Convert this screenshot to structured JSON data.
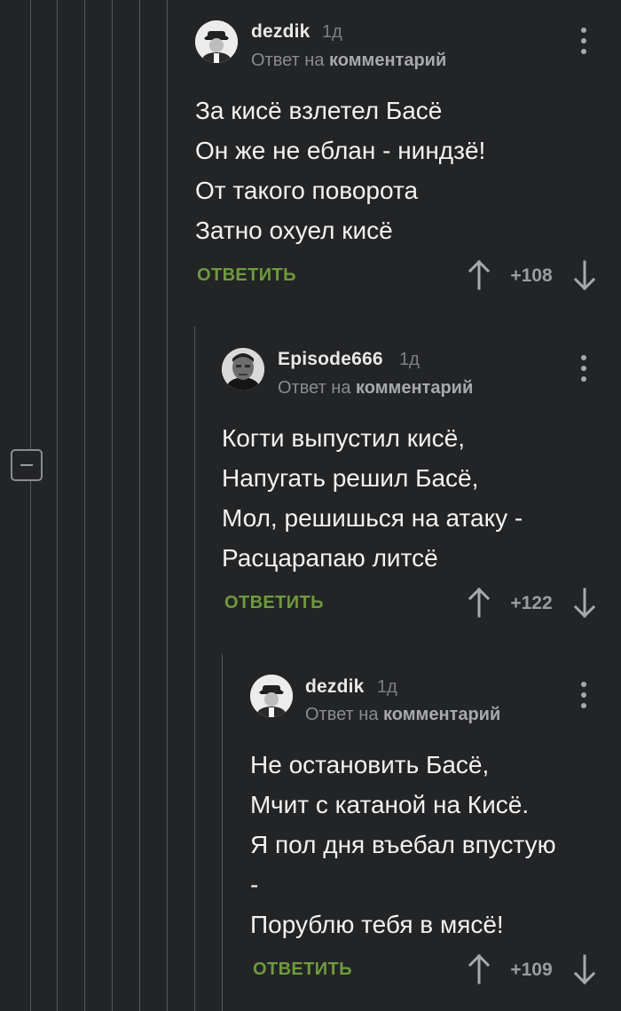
{
  "thread": {
    "collapse_icon": "minus-icon",
    "comments": [
      {
        "author": "dezdik",
        "age": "1д",
        "reply_prefix": "Ответ на",
        "reply_target": "комментарий",
        "lines": [
          "За кисё взлетел Басё",
          "Он же не еблан - ниндзё!",
          "От такого поворота",
          "Затно охуел кисё"
        ],
        "reply_label": "ОТВЕТИТЬ",
        "score": "+108"
      },
      {
        "author": "Episode666",
        "age": "1д",
        "reply_prefix": "Ответ на",
        "reply_target": "комментарий",
        "lines": [
          "Когти выпустил кисё,",
          "Напугать решил Басё,",
          "Мол, решишься на атаку -",
          "Расцарапаю литсё"
        ],
        "reply_label": "ОТВЕТИТЬ",
        "score": "+122"
      },
      {
        "author": "dezdik",
        "age": "1д",
        "reply_prefix": "Ответ на",
        "reply_target": "комментарий",
        "lines": [
          "Не остановить Басё,",
          "Мчит с катаной на Кисё.",
          "Я пол дня въебал впустую",
          "-",
          "Порублю тебя в мясё!"
        ],
        "reply_label": "ОТВЕТИТЬ",
        "score": "+109"
      }
    ]
  },
  "colors": {
    "background": "#232426",
    "reply_button": "#6f9a3f",
    "text": "#f2f2f2",
    "muted": "#8a8c8f"
  }
}
